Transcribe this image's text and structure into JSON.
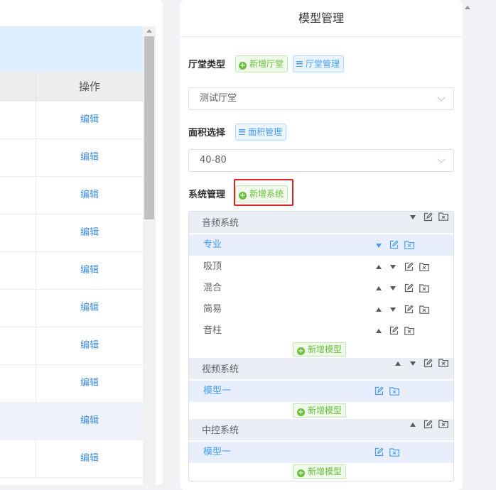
{
  "table": {
    "column_header": "操作",
    "rows": [
      {
        "action": "编辑"
      },
      {
        "action": "编辑"
      },
      {
        "action": "编辑"
      },
      {
        "action": "编辑"
      },
      {
        "action": "编辑"
      },
      {
        "action": "编辑"
      },
      {
        "action": "编辑"
      },
      {
        "action": "编辑"
      },
      {
        "action": "编辑"
      },
      {
        "action": "编辑"
      }
    ]
  },
  "panel": {
    "title": "模型管理",
    "hall_type": {
      "label": "厅堂类型",
      "add_button": "新增厅堂",
      "manage_button": "厅堂管理",
      "selected": "测试厅堂"
    },
    "area": {
      "label": "面积选择",
      "manage_button": "面积管理",
      "selected": "40-80"
    },
    "systems": {
      "label": "系统管理",
      "add_button": "新增系统",
      "add_model_label": "新增模型",
      "groups": [
        {
          "name": "音频系统",
          "items": [
            "专业",
            "吸顶",
            "混合",
            "简易",
            "音柱"
          ]
        },
        {
          "name": "视频系统",
          "items": [
            "模型一"
          ]
        },
        {
          "name": "中控系统",
          "items": [
            "模型一"
          ]
        }
      ]
    }
  },
  "colors": {
    "accent_blue": "#409eff",
    "success_green": "#67c23a",
    "highlight_red": "#e02020",
    "link_blue": "#3c8ede"
  },
  "icons": {
    "move_up": "triangle-up-icon",
    "move_down": "triangle-down-icon",
    "edit": "edit-icon",
    "delete": "folder-delete-icon",
    "add": "plus-circle-icon",
    "manage": "menu-icon"
  }
}
